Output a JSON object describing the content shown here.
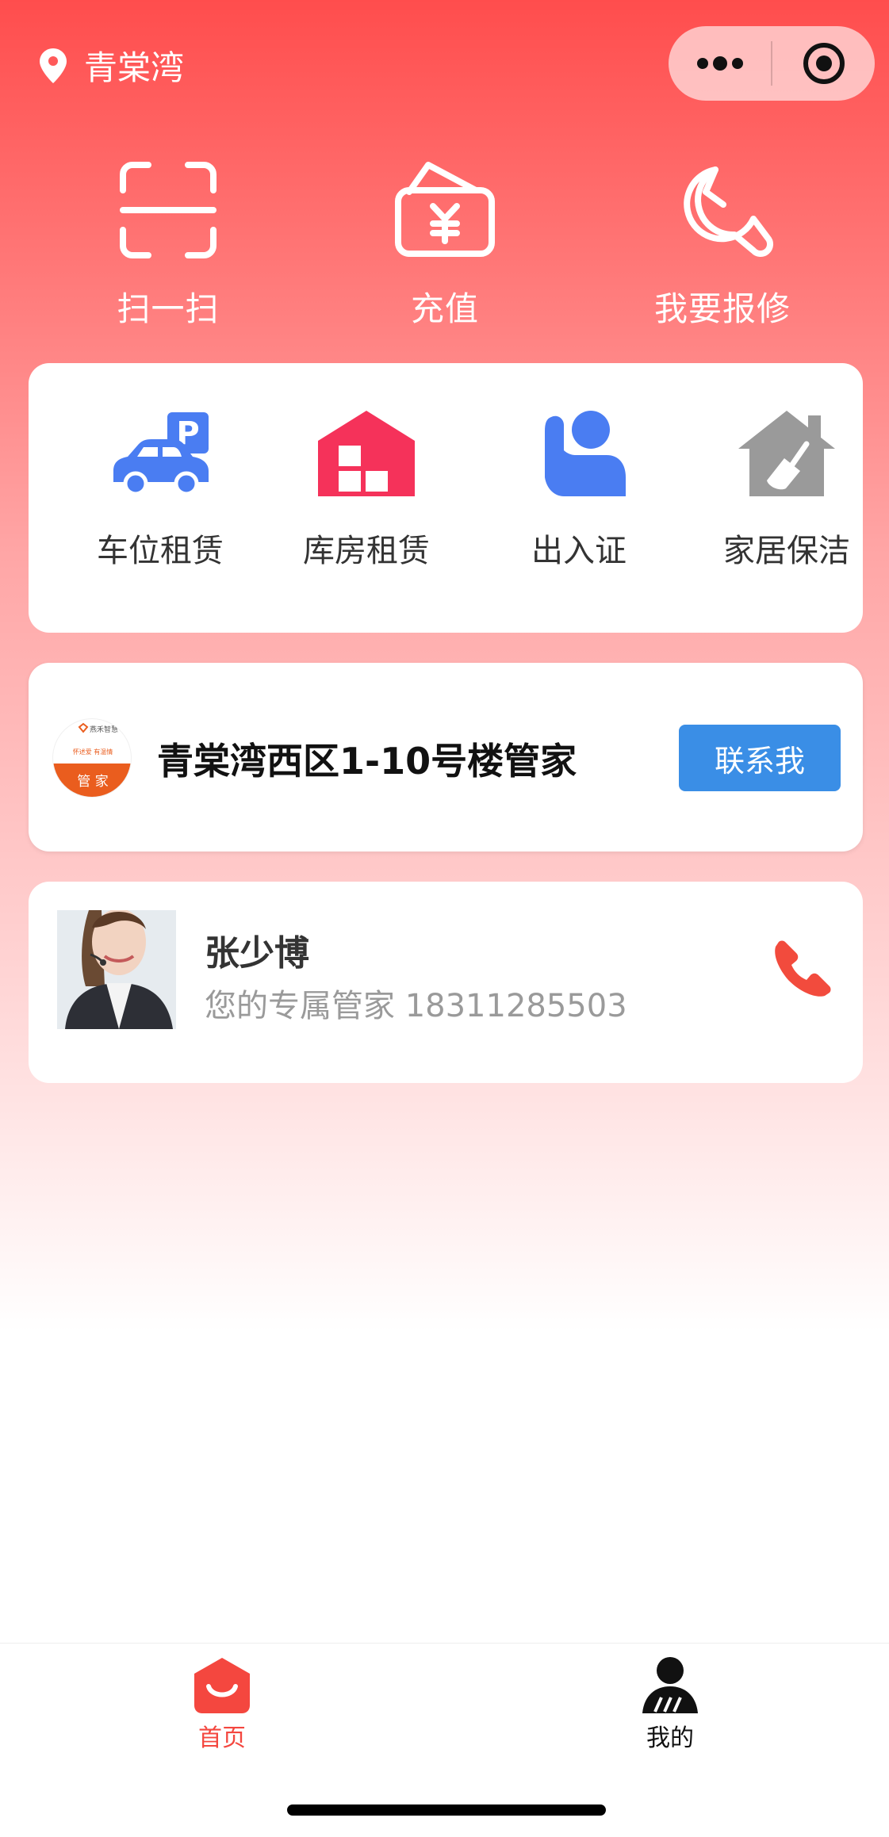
{
  "header": {
    "location": "青棠湾",
    "location_icon": "location-pin-icon",
    "capsule": {
      "more_icon": "more-dots-icon",
      "close_icon": "target-circle-icon"
    }
  },
  "quick_actions": [
    {
      "label": "扫一扫",
      "icon": "scan-icon"
    },
    {
      "label": "充值",
      "icon": "wallet-yen-icon"
    },
    {
      "label": "我要报修",
      "icon": "wrench-icon"
    }
  ],
  "services": [
    {
      "label": "车位租赁",
      "icon": "car-parking-icon",
      "color": "#4a7df2"
    },
    {
      "label": "库房租赁",
      "icon": "warehouse-icon",
      "color": "#f5325a"
    },
    {
      "label": "出入证",
      "icon": "person-pass-icon",
      "color": "#4a7df2"
    },
    {
      "label": "家居保洁",
      "icon": "house-broom-icon",
      "color": "#999999"
    }
  ],
  "butler_card": {
    "title": "青棠湾西区1-10号楼管家",
    "contact_button": "联系我",
    "logo": {
      "brand": "燕禾智慧",
      "slogan": "怀述爱 有温情",
      "badge": "管 家"
    },
    "button_color": "#3a8ee6"
  },
  "manager_card": {
    "name": "张少博",
    "subtitle": "您的专属管家 18311285503",
    "phone_icon": "phone-icon",
    "phone_color": "#f24b3d"
  },
  "tabbar": [
    {
      "label": "首页",
      "icon": "home-icon",
      "active": true,
      "color": "#f4473f"
    },
    {
      "label": "我的",
      "icon": "user-icon",
      "active": false,
      "color": "#111111"
    }
  ]
}
